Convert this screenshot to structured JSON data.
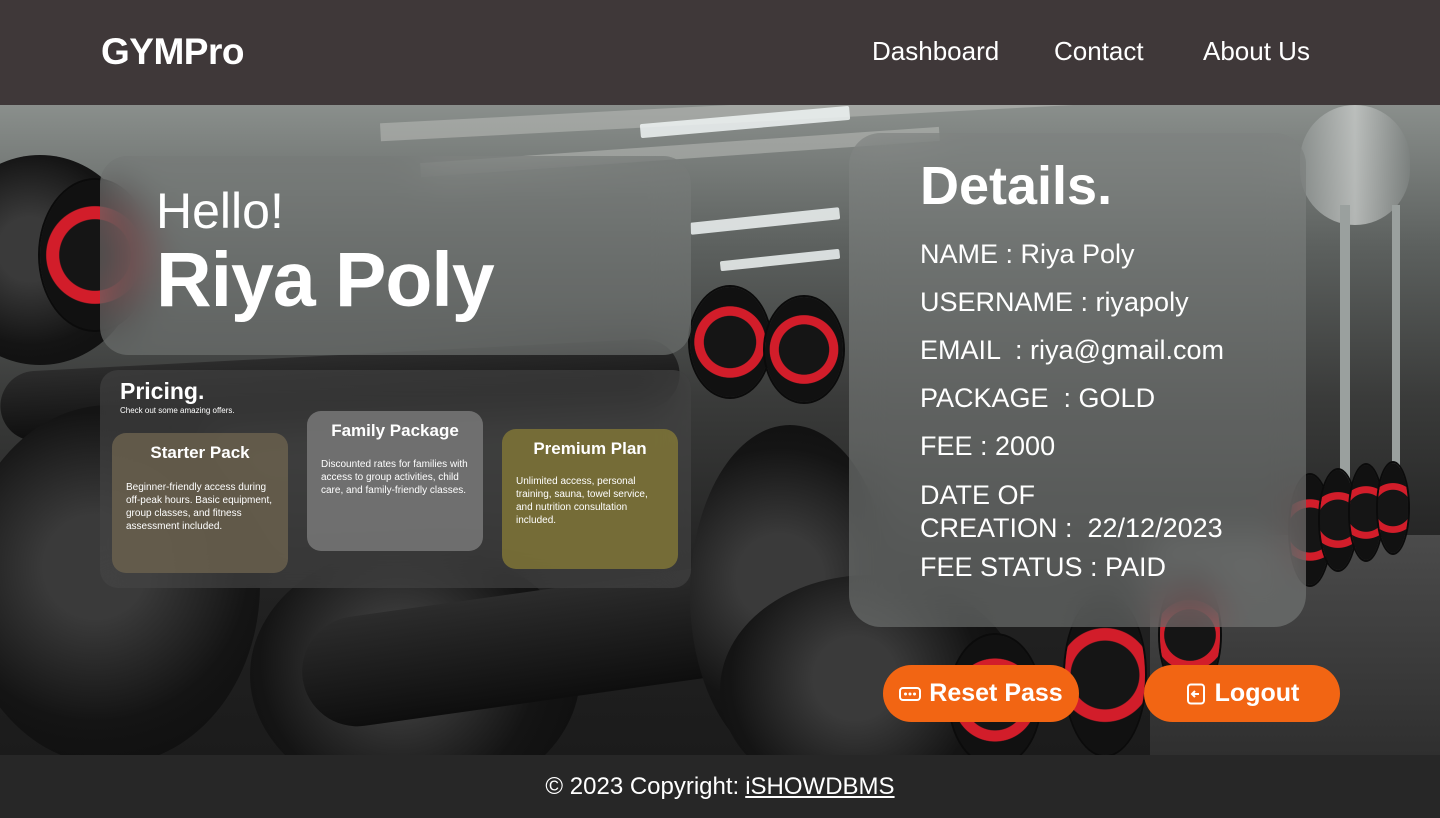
{
  "navbar": {
    "brand": "GYMPro",
    "links": [
      "Dashboard",
      "Contact",
      "About Us"
    ]
  },
  "greeting": {
    "hello": "Hello!",
    "name": "Riya Poly"
  },
  "pricing": {
    "title": "Pricing.",
    "subtitle": "Check out some amazing offers.",
    "plans": [
      {
        "title": "Starter Pack",
        "description": "Beginner-friendly access during off-peak hours. Basic equipment, group classes, and fitness assessment included."
      },
      {
        "title": "Family Package",
        "description": "Discounted rates for families with access to group activities, child care, and family-friendly classes."
      },
      {
        "title": "Premium Plan",
        "description": "Unlimited access, personal training, sauna, towel service, and nutrition consultation included."
      }
    ]
  },
  "details": {
    "title": "Details.",
    "name": "NAME : Riya Poly",
    "username": "USERNAME : riyapoly",
    "email": "EMAIL  : riya@gmail.com",
    "package": "PACKAGE  : GOLD",
    "fee": "FEE : 2000",
    "date_line1": "DATE OF",
    "date_line2": "CREATION :  22/12/2023",
    "fee_status": "FEE STATUS : PAID"
  },
  "actions": {
    "reset_label": "Reset Pass",
    "logout_label": "Logout"
  },
  "footer": {
    "copyright": "© 2023 Copyright:",
    "link": "iSHOWDBMS"
  },
  "colors": {
    "accent": "#f26513",
    "navbar_bg": "#3f3839"
  }
}
